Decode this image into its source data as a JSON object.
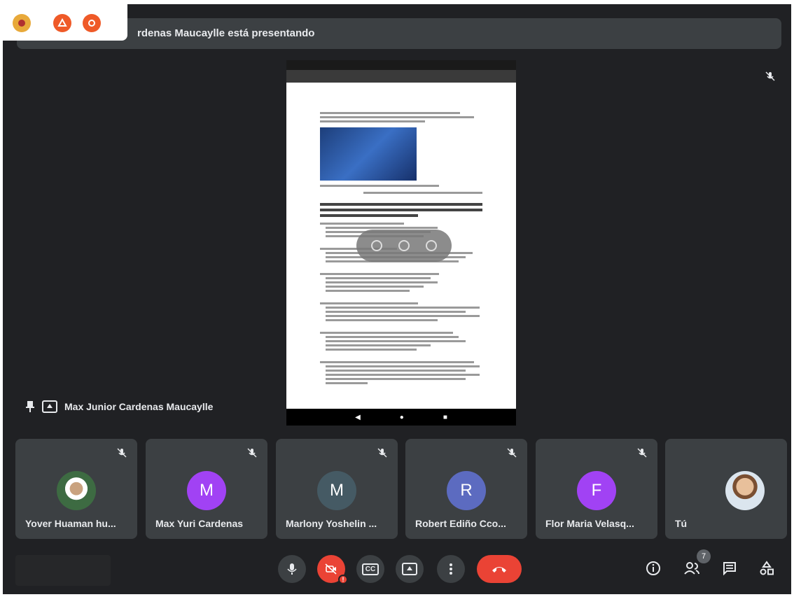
{
  "banner": {
    "text": "rdenas Maucaylle está presentando"
  },
  "extensions": [
    {
      "name": "extension-icon-1",
      "color": "#e0a030"
    },
    {
      "name": "extension-icon-2",
      "color": "#ef5a28"
    },
    {
      "name": "extension-icon-3",
      "color": "#ef5a28"
    }
  ],
  "presenter": {
    "name": "Max Junior Cardenas Maucaylle"
  },
  "participants": [
    {
      "name": "Yover Huaman hu...",
      "avatar": "photo",
      "muted": true
    },
    {
      "name": "Max Yuri Cardenas",
      "initial": "M",
      "color": "#a142f4",
      "muted": true
    },
    {
      "name": "Marlony Yoshelin ...",
      "initial": "M",
      "color": "#455a64",
      "muted": true
    },
    {
      "name": "Robert Ediño Cco...",
      "initial": "R",
      "color": "#5c6bc0",
      "muted": true
    },
    {
      "name": "Flor Maria Velasq...",
      "initial": "F",
      "color": "#a142f4",
      "muted": true
    },
    {
      "name": "Tú",
      "avatar": "photo",
      "muted": false
    }
  ],
  "controls": {
    "captions_label": "CC",
    "camera_alert": "!",
    "participants_count": "7"
  },
  "colors": {
    "background": "#202124",
    "tile": "#3c4043",
    "accent_red": "#ea4335"
  }
}
